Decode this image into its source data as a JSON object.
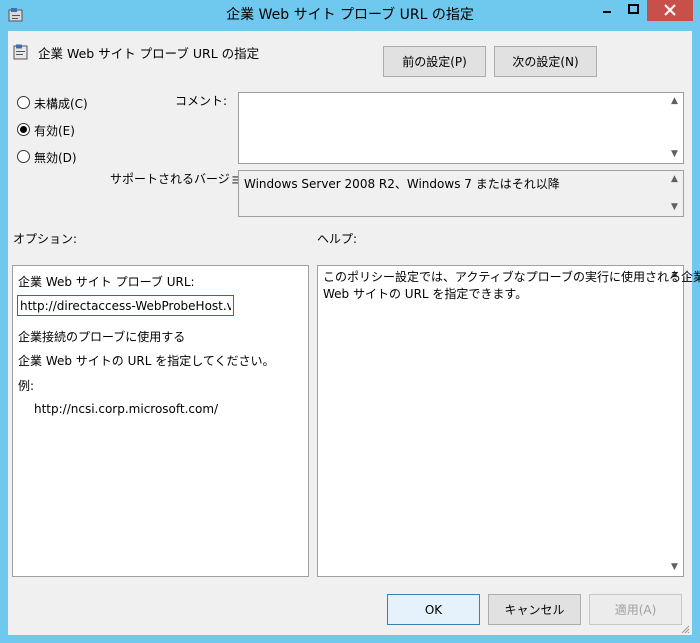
{
  "window": {
    "title": "企業 Web サイト プローブ URL の指定"
  },
  "header": {
    "policy_name": "企業 Web サイト プローブ URL の指定",
    "prev_button": "前の設定(P)",
    "next_button": "次の設定(N)"
  },
  "state": {
    "options": [
      {
        "label": "未構成(C)",
        "selected": false
      },
      {
        "label": "有効(E)",
        "selected": true
      },
      {
        "label": "無効(D)",
        "selected": false
      }
    ]
  },
  "comment": {
    "label": "コメント:",
    "value": ""
  },
  "supported": {
    "label": "サポートされるバージョン:",
    "value": "Windows Server 2008 R2、Windows 7 またはそれ以降"
  },
  "options_panel": {
    "heading": "オプション:",
    "url_label": "企業 Web サイト プローブ URL:",
    "url_value": "http://directaccess-WebProbeHost.vv",
    "description_line1": "企業接続のプローブに使用する",
    "description_line2": "企業 Web サイトの URL を指定してください。",
    "example_label": "例:",
    "example_value": "http://ncsi.corp.microsoft.com/"
  },
  "help_panel": {
    "heading": "ヘルプ:",
    "text_line1": "このポリシー設定では、アクティブなプローブの実行に使用される企業",
    "text_line2": "Web サイトの URL を指定できます。"
  },
  "footer": {
    "ok": "OK",
    "cancel": "キャンセル",
    "apply": "適用(A)"
  }
}
